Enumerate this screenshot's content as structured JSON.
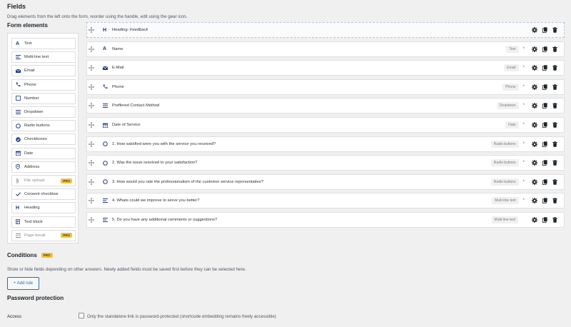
{
  "fields_section": {
    "title": "Fields",
    "description": "Drag elements from the left onto the form, reorder using the handle, edit using the gear icon."
  },
  "palette": {
    "title": "Form elements",
    "items": [
      {
        "label": "Text",
        "icon": "text-icon",
        "pro": false,
        "disabled": false
      },
      {
        "label": "Multi-line text",
        "icon": "paragraph-icon",
        "pro": false,
        "disabled": false
      },
      {
        "label": "Email",
        "icon": "envelope-icon",
        "pro": false,
        "disabled": false
      },
      {
        "label": "Phone",
        "icon": "phone-icon",
        "pro": false,
        "disabled": false
      },
      {
        "label": "Number",
        "icon": "number-icon",
        "pro": false,
        "disabled": false
      },
      {
        "label": "Dropdown",
        "icon": "list-icon",
        "pro": false,
        "disabled": false
      },
      {
        "label": "Radio buttons",
        "icon": "radio-icon",
        "pro": false,
        "disabled": false
      },
      {
        "label": "Checkboxes",
        "icon": "checkbox-icon",
        "pro": false,
        "disabled": false
      },
      {
        "label": "Date",
        "icon": "calendar-icon",
        "pro": false,
        "disabled": false
      },
      {
        "label": "Address",
        "icon": "location-pin-icon",
        "pro": false,
        "disabled": false
      },
      {
        "label": "File upload",
        "icon": "paperclip-icon",
        "pro": true,
        "disabled": true
      },
      {
        "label": "Consent checkbox",
        "icon": "checkmark-icon",
        "pro": false,
        "disabled": false
      },
      {
        "label": "Heading",
        "icon": "heading-icon",
        "pro": false,
        "disabled": false
      },
      {
        "label": "Text block",
        "icon": "text-block-icon",
        "pro": false,
        "disabled": false
      },
      {
        "label": "Page break",
        "icon": "page-break-icon",
        "pro": true,
        "disabled": true
      }
    ],
    "pro_label": "PRO"
  },
  "fields": [
    {
      "heading_prefix": "Heading: ",
      "heading_text": "Feedback",
      "type": "",
      "required": false,
      "icon": "heading-icon",
      "is_heading": true
    },
    {
      "label": "Name",
      "type": "Text",
      "required": true,
      "icon": "text-icon"
    },
    {
      "label": "E-Mail",
      "type": "Email",
      "required": true,
      "icon": "envelope-icon"
    },
    {
      "label": "Phone",
      "type": "Phone",
      "required": true,
      "icon": "phone-icon"
    },
    {
      "label": "Preffered Contact Method",
      "type": "Dropdown",
      "required": true,
      "icon": "list-icon"
    },
    {
      "label": "Date of Service",
      "type": "Date",
      "required": true,
      "icon": "calendar-icon"
    },
    {
      "label": "1. How satisfied were you with the service you received?",
      "type": "Radio buttons",
      "required": true,
      "icon": "radio-icon"
    },
    {
      "label": "2. Was the issue resolved to your satisfaction?",
      "type": "Radio buttons",
      "required": true,
      "icon": "radio-icon"
    },
    {
      "label": "3. How would you rate the professionalism of the customer service representative?",
      "type": "Radio buttons",
      "required": true,
      "icon": "radio-icon"
    },
    {
      "label": "4. Whats could we improve to serve you better?",
      "type": "Multi-line text",
      "required": true,
      "icon": "paragraph-icon"
    },
    {
      "label": "5. Do you have any additional comments or suggestions?",
      "type": "Multi-line text",
      "required": false,
      "icon": "paragraph-icon"
    }
  ],
  "required_mark": "*",
  "conditions": {
    "title": "Conditions",
    "pro_label": "PRO",
    "description": "Show or hide fields depending on other answers. Newly added fields must be saved first before they can be selected here.",
    "add_rule_label": "+ Add rule"
  },
  "password": {
    "title": "Password protection",
    "access_label": "Access",
    "access_option": "Only the standalone link is password-protected (shortcode embedding remains freely accessible)",
    "access_checked": false
  },
  "colors": {
    "accent": "#2271b1",
    "icon_blue": "#1e3a8a",
    "pro_badge": "#f0c33c",
    "required": "#d63638"
  }
}
